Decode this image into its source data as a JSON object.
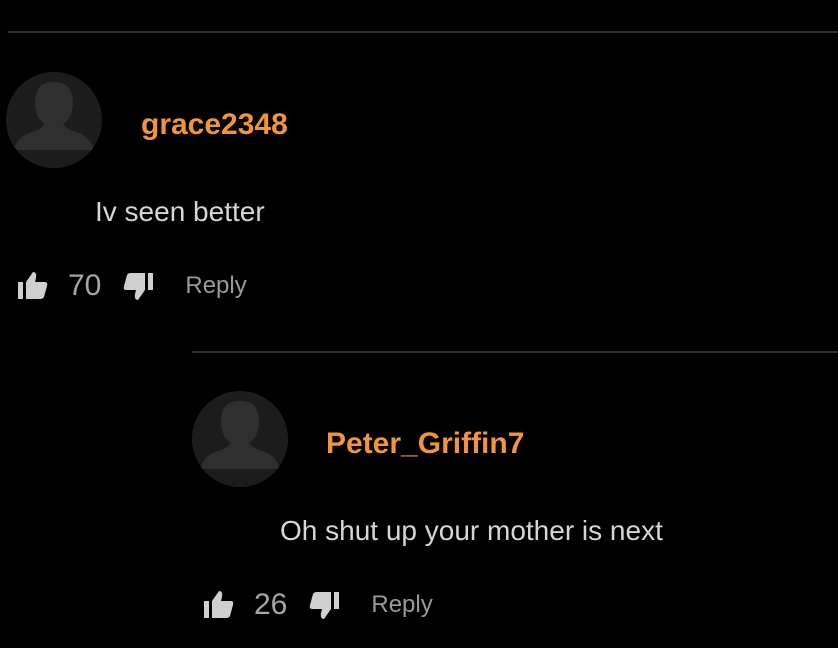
{
  "colors": {
    "background": "#000000",
    "username": "#f0953c",
    "comment_text": "#d6d6d6",
    "vote_count": "#a6a6a6",
    "reply": "#9a9a9a",
    "icon": "#cfcfcf",
    "divider": "#2b2b2b"
  },
  "comments": [
    {
      "avatar_icon": "default-avatar-icon",
      "username": "grace2348",
      "text": "Iv seen better",
      "likes": "70",
      "like_icon": "thumbs-up-icon",
      "dislike_icon": "thumbs-down-icon",
      "reply_label": "Reply"
    },
    {
      "avatar_icon": "default-avatar-icon",
      "username": "Peter_Griffin7",
      "text": "Oh shut up your mother is next",
      "likes": "26",
      "like_icon": "thumbs-up-icon",
      "dislike_icon": "thumbs-down-icon",
      "reply_label": "Reply"
    }
  ]
}
